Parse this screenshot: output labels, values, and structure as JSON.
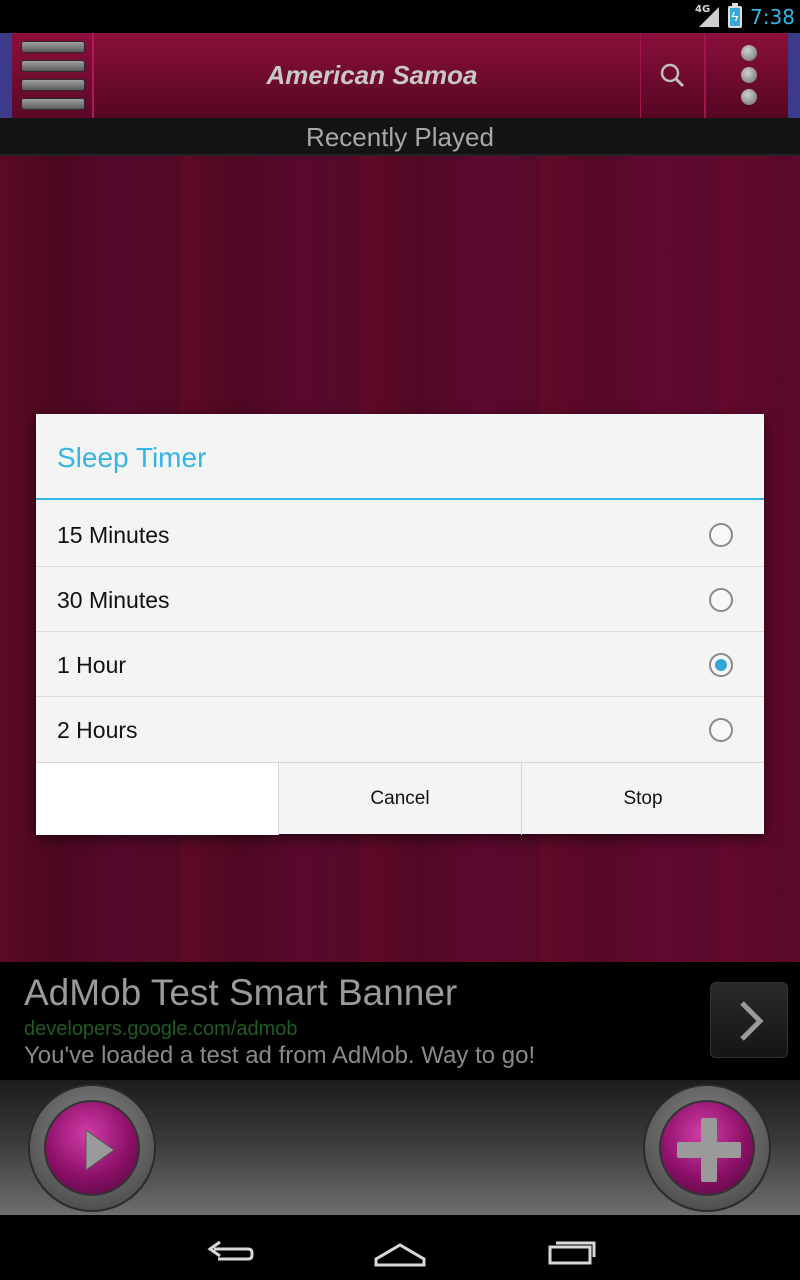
{
  "status_bar": {
    "network": "4G",
    "time": "7:38",
    "icons": [
      "signal-icon",
      "battery-charging-icon"
    ]
  },
  "action_bar": {
    "title": "American Samoa",
    "icons": [
      "menu-icon",
      "search-icon",
      "overflow-menu-icon"
    ]
  },
  "section_header": "Recently Played",
  "dialog": {
    "title": "Sleep Timer",
    "options": [
      {
        "label": "15 Minutes",
        "selected": false
      },
      {
        "label": "30 Minutes",
        "selected": false
      },
      {
        "label": "1 Hour",
        "selected": true
      },
      {
        "label": "2 Hours",
        "selected": false
      }
    ],
    "buttons": {
      "empty": "",
      "cancel": "Cancel",
      "stop": "Stop"
    }
  },
  "ad": {
    "title": "AdMob Test Smart Banner",
    "url": "developers.google.com/admob",
    "text": "You've loaded a test ad from AdMob. Way to go!"
  },
  "player": {
    "icons": [
      "play-icon",
      "plus-icon"
    ]
  },
  "nav_bar": {
    "icons": [
      "back-icon",
      "home-icon",
      "recent-apps-icon"
    ]
  },
  "colors": {
    "accent": "#33b5e5",
    "toolbar": "#6b0a2c",
    "background": "#4e0a25",
    "player_button": "#8c1068"
  }
}
